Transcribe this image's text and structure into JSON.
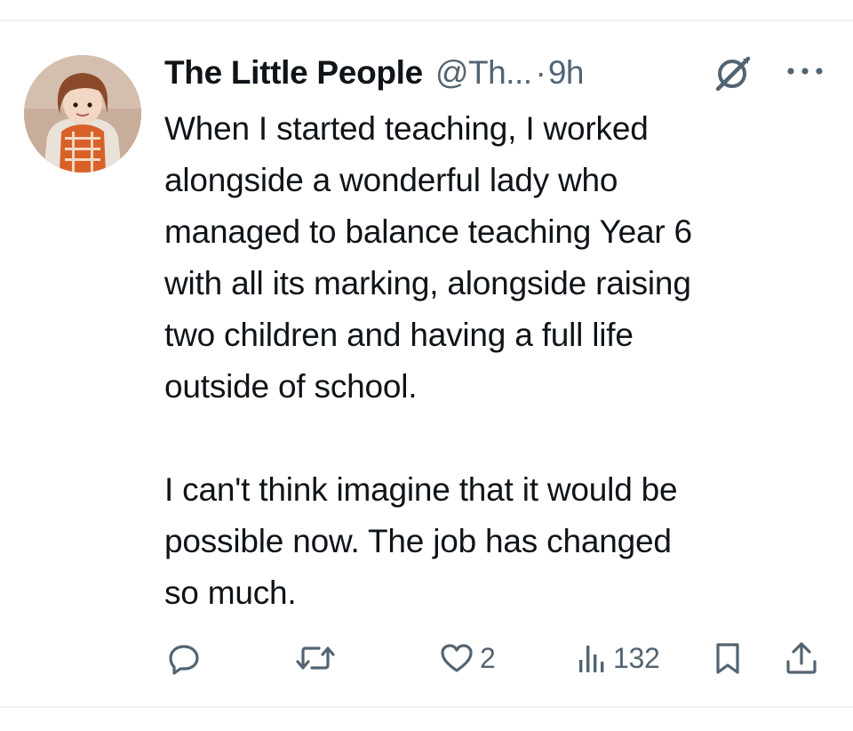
{
  "author": {
    "display_name": "The Little People",
    "handle": "@Th...",
    "separator": "·",
    "time": "9h"
  },
  "tweet": {
    "text": "When I started teaching, I worked\nalongside a wonderful lady who\nmanaged to balance teaching Year 6\nwith all its marking, alongside raising\ntwo children and having a full life\noutside of school.\n\nI can't think imagine that it would be\npossible now. The job has changed\nso much."
  },
  "actions": {
    "reply_icon": "reply-icon",
    "retweet_icon": "retweet-icon",
    "like_icon": "heart-icon",
    "like_count": "2",
    "views_icon": "views-bar-chart-icon",
    "views_count": "132",
    "bookmark_icon": "bookmark-icon",
    "share_icon": "share-icon"
  },
  "header_icons": {
    "grok": "grok-icon",
    "more": "more-dots-icon"
  },
  "colors": {
    "text_primary": "#0f1419",
    "text_secondary": "#536471",
    "divider": "#eff3f4"
  }
}
